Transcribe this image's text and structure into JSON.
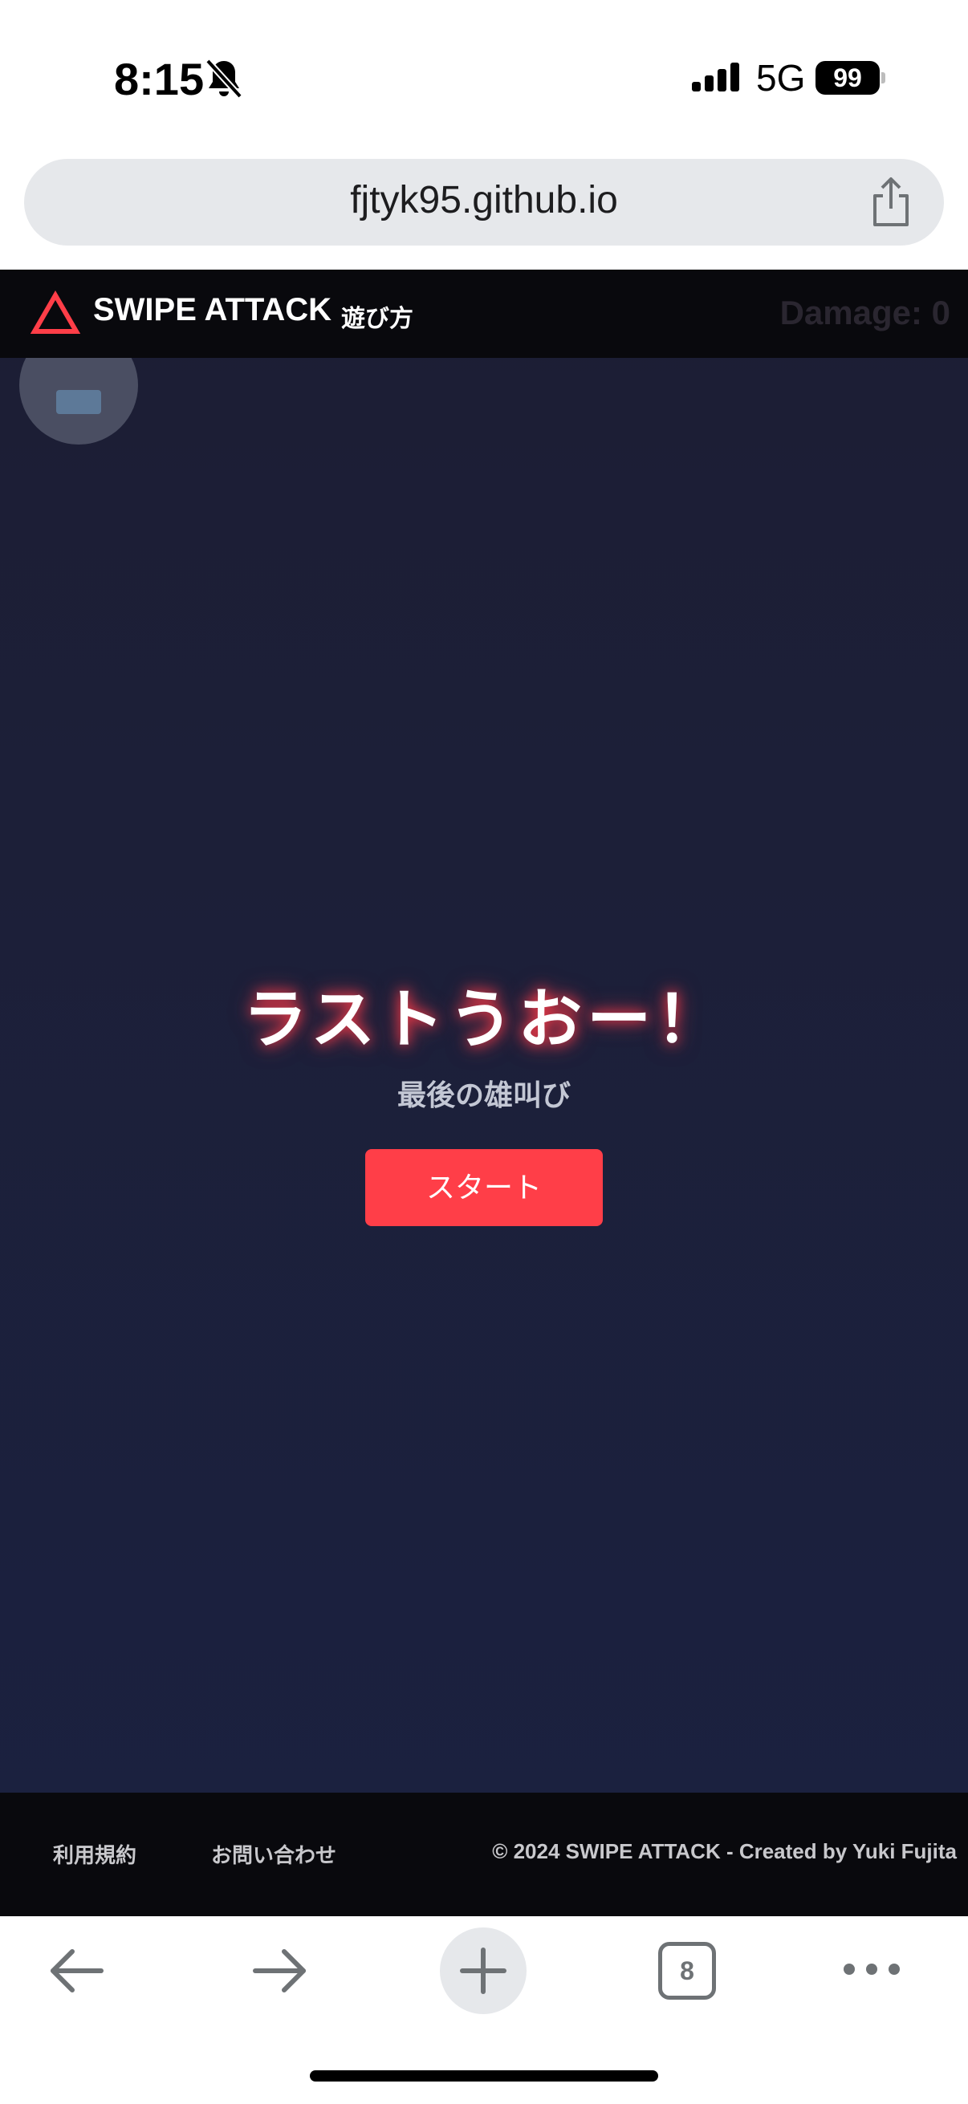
{
  "status_bar": {
    "time": "8:15",
    "network": "5G",
    "battery": "99",
    "icons": [
      "bell-muted-icon",
      "signal-icon"
    ]
  },
  "browser": {
    "url": "fjtyk95.github.io",
    "open_tab_count": "8",
    "icons": [
      "share-icon",
      "back-icon",
      "forward-icon",
      "new-tab-icon",
      "more-icon"
    ]
  },
  "header": {
    "brand": "SWIPE ATTACK",
    "how_to_play": "遊び方",
    "damage": "Damage: 0",
    "logo_icon": "triangle-logo-icon"
  },
  "game": {
    "title": "ラストうおー！",
    "subtitle": "最後の雄叫び",
    "start_label": "スタート"
  },
  "footer": {
    "terms": "利用規約",
    "contact": "お問い合わせ",
    "copyright": "© 2024 SWIPE ATTACK - Created by Yuki Fujita"
  },
  "colors": {
    "accent": "#ff3e48",
    "page_background": "#1b1f3a",
    "header_background": "#09090d"
  }
}
